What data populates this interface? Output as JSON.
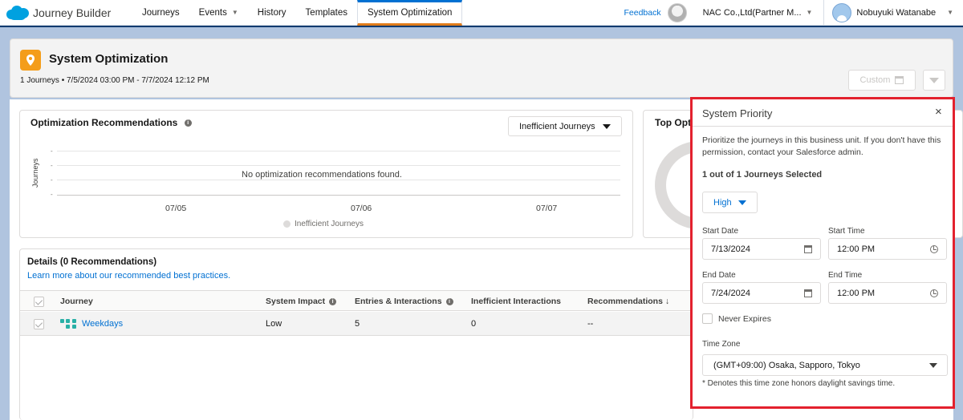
{
  "nav": {
    "app_title": "Journey Builder",
    "tabs": [
      {
        "label": "Journeys"
      },
      {
        "label": "Events"
      },
      {
        "label": "History"
      },
      {
        "label": "Templates"
      },
      {
        "label": "System Optimization"
      }
    ],
    "feedback": "Feedback",
    "business_unit": "NAC Co.,Ltd(Partner M...",
    "user": "Nobuyuki Watanabe"
  },
  "header": {
    "title": "System Optimization",
    "subtitle": "1 Journeys • 7/5/2024 03:00 PM - 7/7/2024 12:12 PM",
    "custom_label": "Custom"
  },
  "recommendations": {
    "title": "Optimization Recommendations",
    "filter_label": "Inefficient Journeys",
    "chart_data": {
      "type": "line",
      "ylabel": "Journeys",
      "categories": [
        "07/05",
        "07/06",
        "07/07"
      ],
      "series": [
        {
          "name": "Inefficient Journeys",
          "values": []
        }
      ],
      "empty_message": "No optimization recommendations found."
    }
  },
  "top_card": {
    "title": "Top Opti"
  },
  "details": {
    "title": "Details (0 Recommendations)",
    "link": "Learn more about our recommended best practices.",
    "columns": [
      "Journey",
      "System Impact",
      "Entries & Interactions",
      "Inefficient Interactions",
      "Recommendations ↓"
    ],
    "rows": [
      {
        "journey": "Weekdays",
        "impact": "Low",
        "entries": "5",
        "inefficient": "0",
        "recommendations": "--"
      }
    ]
  },
  "panel": {
    "title": "System Priority",
    "close": "×",
    "description": "Prioritize the journeys in this business unit. If you don't have this permission, contact your Salesforce admin.",
    "selected": "1 out of 1 Journeys Selected",
    "priority": "High",
    "start_date_label": "Start Date",
    "start_date": "7/13/2024",
    "start_time_label": "Start Time",
    "start_time": "12:00 PM",
    "end_date_label": "End Date",
    "end_date": "7/24/2024",
    "end_time_label": "End Time",
    "end_time": "12:00 PM",
    "never_expires": "Never Expires",
    "timezone_label": "Time Zone",
    "timezone": "(GMT+09:00) Osaka, Sapporo, Tokyo",
    "timezone_note": "* Denotes this time zone honors daylight savings time."
  },
  "colors": {
    "accent": "#0070d2",
    "highlight_border": "#e3212e",
    "brand_icon": "#f49d1a"
  }
}
